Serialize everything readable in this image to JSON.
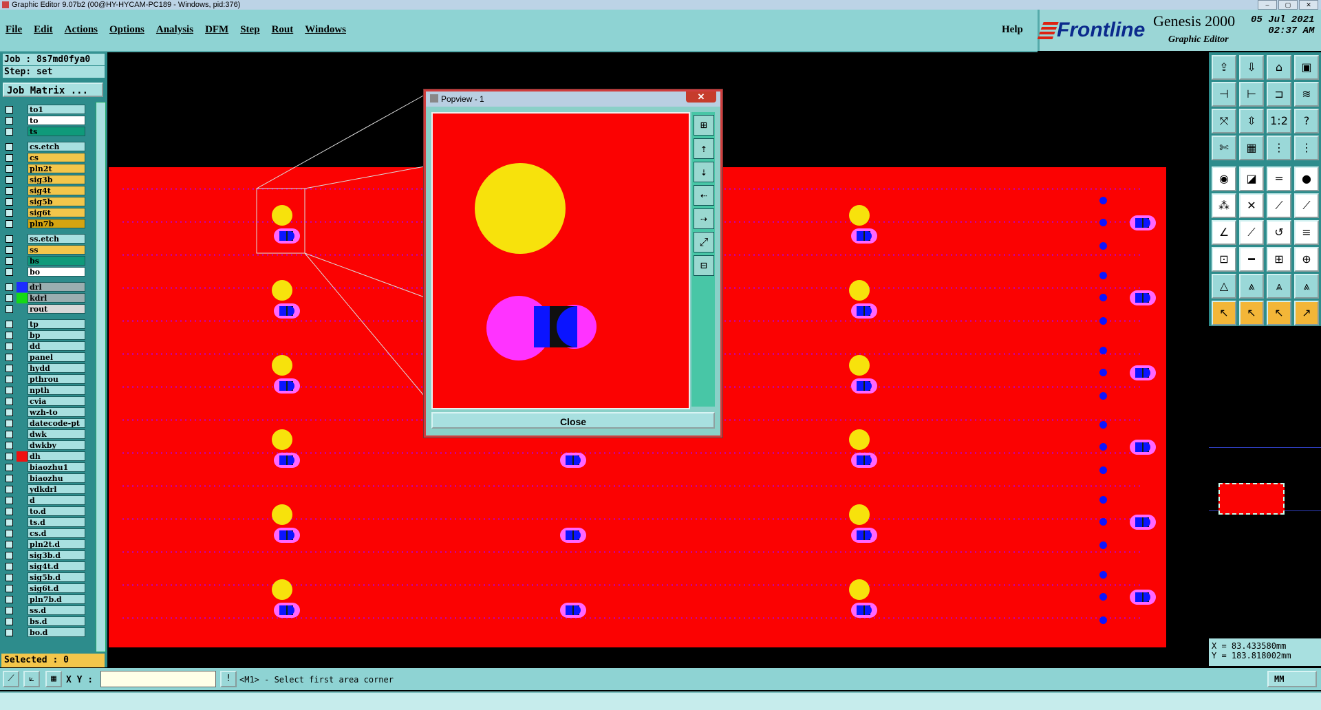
{
  "window": {
    "title": "Graphic Editor 9.07b2 (00@HY-HYCAM-PC189 - Windows, pid:376)"
  },
  "menu": {
    "items": [
      "File",
      "Edit",
      "Actions",
      "Options",
      "Analysis",
      "DFM",
      "Step",
      "Rout",
      "Windows"
    ],
    "help": "Help"
  },
  "brand": {
    "logo": "Frontline",
    "product": "Genesis 2000",
    "subtitle": "Graphic Editor",
    "date": "05 Jul 2021",
    "time": "02:37 AM"
  },
  "job": {
    "job_label": "Job : 8s7md0fya0",
    "step_label": "Step: set",
    "matrix_button": "Job Matrix ..."
  },
  "layers": [
    {
      "name": "to1",
      "color": "#a8e0e0"
    },
    {
      "name": "to",
      "color": "#ffffff"
    },
    {
      "name": "ts",
      "color": "#0f9a7a"
    },
    {
      "name": "cs.etch",
      "color": "#a8e0e0"
    },
    {
      "name": "cs",
      "color": "#f3c64b"
    },
    {
      "name": "pln2t",
      "color": "#f3c64b"
    },
    {
      "name": "sig3b",
      "color": "#f3c64b"
    },
    {
      "name": "sig4t",
      "color": "#f3c64b"
    },
    {
      "name": "sig5b",
      "color": "#f3c64b"
    },
    {
      "name": "sig6t",
      "color": "#f3c64b"
    },
    {
      "name": "pln7b",
      "color": "#d4a410"
    },
    {
      "name": "ss.etch",
      "color": "#a8e0e0"
    },
    {
      "name": "ss",
      "color": "#f3c64b"
    },
    {
      "name": "bs",
      "color": "#0f9a7a"
    },
    {
      "name": "bo",
      "color": "#ffffff"
    },
    {
      "name": "drl",
      "color": "#9aaeb0",
      "swatch": "#1d2cff"
    },
    {
      "name": "kdrl",
      "color": "#9aaeb0",
      "swatch": "#16d916"
    },
    {
      "name": "rout",
      "color": "#d8d8d8"
    },
    {
      "name": "tp",
      "color": "#a8e0e0"
    },
    {
      "name": "bp",
      "color": "#a8e0e0"
    },
    {
      "name": "dd",
      "color": "#a8e0e0"
    },
    {
      "name": "panel",
      "color": "#a8e0e0"
    },
    {
      "name": "hydd",
      "color": "#a8e0e0"
    },
    {
      "name": "pthrou",
      "color": "#a8e0e0"
    },
    {
      "name": "npth",
      "color": "#a8e0e0"
    },
    {
      "name": "cvia",
      "color": "#a8e0e0"
    },
    {
      "name": "wzh-to",
      "color": "#a8e0e0"
    },
    {
      "name": "datecode-pt",
      "color": "#a8e0e0"
    },
    {
      "name": "dwk",
      "color": "#a8e0e0"
    },
    {
      "name": "dwkby",
      "color": "#a8e0e0"
    },
    {
      "name": "dh",
      "color": "#a8e0e0",
      "swatch": "#f01010",
      "active": true
    },
    {
      "name": "biaozhu1",
      "color": "#a8e0e0"
    },
    {
      "name": "biaozhu",
      "color": "#a8e0e0"
    },
    {
      "name": "ydkdrl",
      "color": "#a8e0e0"
    },
    {
      "name": "d",
      "color": "#a8e0e0"
    },
    {
      "name": "to.d",
      "color": "#a8e0e0"
    },
    {
      "name": "ts.d",
      "color": "#a8e0e0"
    },
    {
      "name": "cs.d",
      "color": "#a8e0e0"
    },
    {
      "name": "pln2t.d",
      "color": "#a8e0e0"
    },
    {
      "name": "sig3b.d",
      "color": "#a8e0e0"
    },
    {
      "name": "sig4t.d",
      "color": "#a8e0e0"
    },
    {
      "name": "sig5b.d",
      "color": "#a8e0e0"
    },
    {
      "name": "sig6t.d",
      "color": "#a8e0e0"
    },
    {
      "name": "pln7b.d",
      "color": "#a8e0e0"
    },
    {
      "name": "ss.d",
      "color": "#a8e0e0"
    },
    {
      "name": "bs.d",
      "color": "#a8e0e0"
    },
    {
      "name": "bo.d",
      "color": "#a8e0e0"
    }
  ],
  "selected_label": "Selected : 0",
  "popview": {
    "title": "Popview - 1",
    "close_label": "Close"
  },
  "coords": {
    "x": "X = 83.433580mm",
    "y": "Y = 183.818002mm"
  },
  "bottom": {
    "xy_label": "X Y :",
    "xy_value": "",
    "message": "<M1> - Select first area corner",
    "units": "MM"
  },
  "colors": {
    "board": "#fb0202",
    "pad_yellow": "#f7e20c",
    "pad_magenta": "#ff44ff",
    "drill_blue": "#0b14ff",
    "ui_teal": "#8ed3d3"
  }
}
